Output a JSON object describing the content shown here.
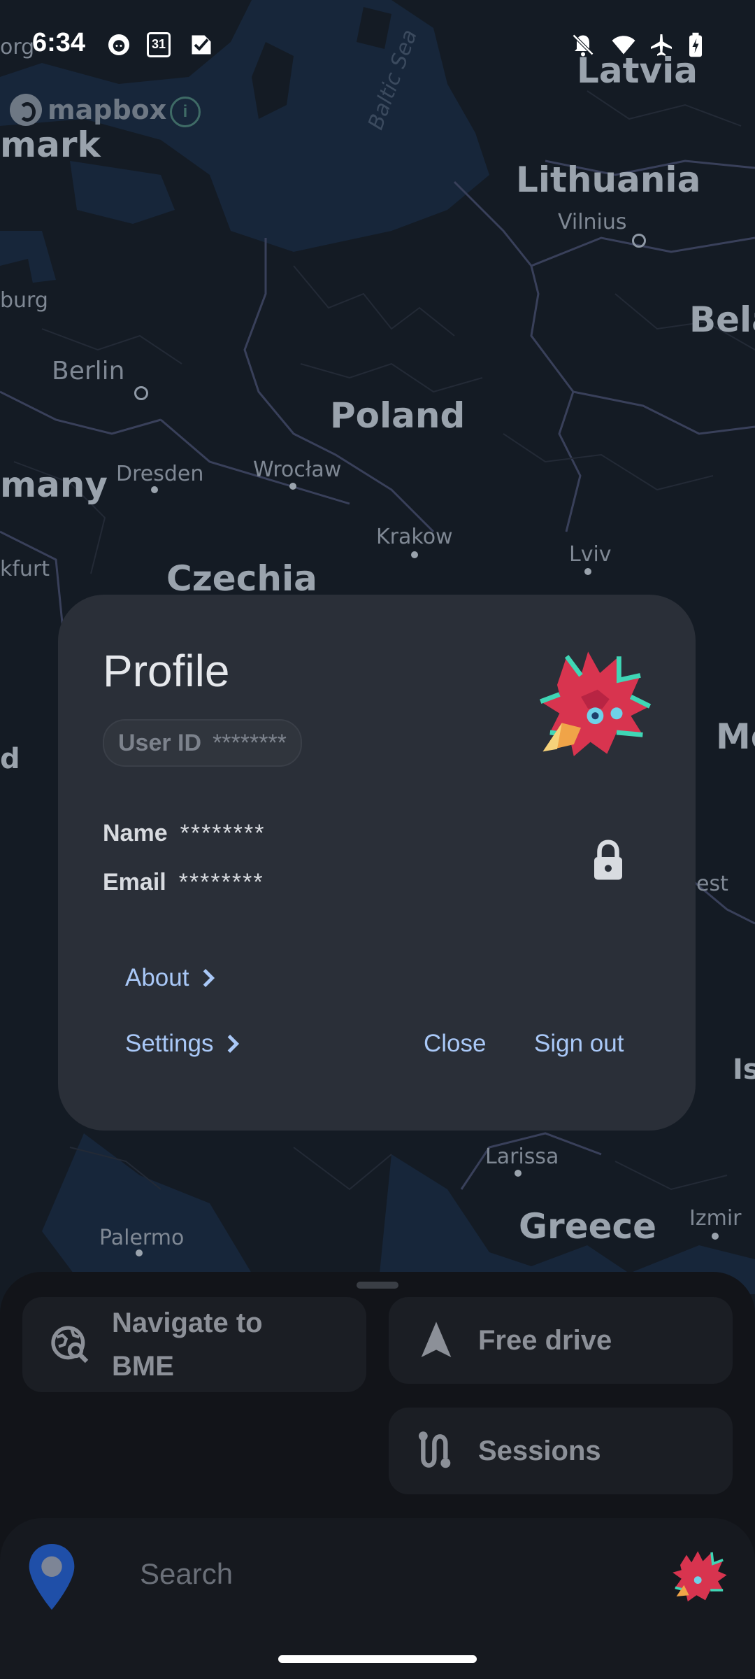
{
  "status_bar": {
    "time": "6:34",
    "left_icons": [
      "github-icon",
      "calendar-icon",
      "tasks-check-icon"
    ],
    "calendar_day": "31",
    "right_icons": [
      "bell-off-icon",
      "wifi-icon",
      "airplane-icon",
      "battery-charging-icon"
    ]
  },
  "map": {
    "attribution": "mapbox",
    "info_icon": "info-icon",
    "countries": [
      "Latvia",
      "Lithuania",
      "Bela",
      "Poland",
      "Czechia",
      "mark",
      "many",
      "Greece",
      "Mo"
    ],
    "cities": [
      "Vilnius",
      "Berlin",
      "Dresden",
      "Wrocław",
      "Krakow",
      "Lviv",
      "Larissa",
      "Palermo",
      "Izmir",
      "burg",
      "kfurt",
      "org",
      "est",
      "Is",
      "d"
    ],
    "sea": "Baltic Sea"
  },
  "profile_dialog": {
    "title": "Profile",
    "user_id_label": "User ID",
    "user_id_value": "********",
    "name_label": "Name",
    "name_value": "********",
    "email_label": "Email",
    "email_value": "********",
    "lock_icon": "lock-icon",
    "about_label": "About",
    "settings_label": "Settings",
    "close_label": "Close",
    "sign_out_label": "Sign out"
  },
  "bottom_sheet": {
    "navigate_label": "Navigate to BME",
    "navigate_icon": "location-search-icon",
    "free_drive_label": "Free drive",
    "free_drive_icon": "navigation-arrow-icon",
    "sessions_label": "Sessions",
    "sessions_icon": "route-icon"
  },
  "search": {
    "placeholder": "Search",
    "pin_icon": "map-pin-icon"
  },
  "colors": {
    "map_background": "#131a23",
    "dialog_background": "#2a2f38",
    "accent_link": "#a9c8f7",
    "pin_blue": "#1f4fa8",
    "avatar_red": "#d8344f",
    "avatar_teal": "#3fd6b5"
  }
}
